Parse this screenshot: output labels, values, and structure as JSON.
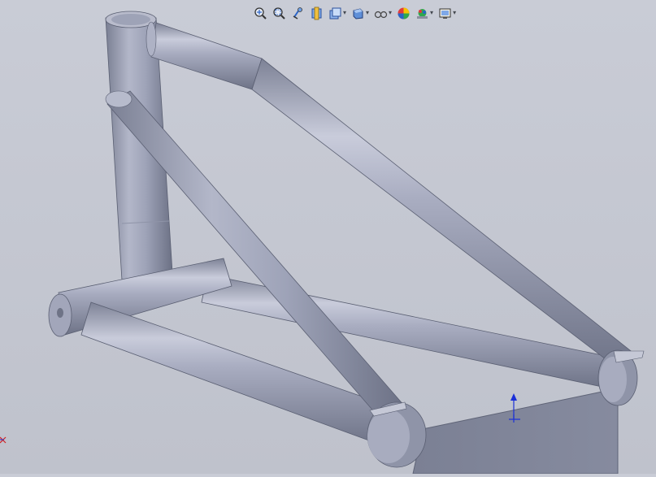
{
  "viewport": {
    "background_top": "#c9ccd6",
    "background_bottom": "#bfc2cc",
    "model_color": "#9ea3b8"
  },
  "view_toolbar": {
    "items": [
      {
        "name": "zoom-to-fit",
        "icon": "zoom-to-fit-icon",
        "has_dropdown": false
      },
      {
        "name": "zoom-to-area",
        "icon": "zoom-to-area-icon",
        "has_dropdown": false
      },
      {
        "name": "previous-view",
        "icon": "previous-view-icon",
        "has_dropdown": false
      },
      {
        "name": "section-view",
        "icon": "section-view-icon",
        "has_dropdown": false
      },
      {
        "name": "view-orientation",
        "icon": "view-orientation-icon",
        "has_dropdown": true
      },
      {
        "name": "display-style",
        "icon": "display-style-icon",
        "has_dropdown": true
      },
      {
        "name": "hide-show-items",
        "icon": "hide-show-items-icon",
        "has_dropdown": true
      },
      {
        "name": "edit-appearance",
        "icon": "edit-appearance-icon",
        "has_dropdown": false
      },
      {
        "name": "apply-scene",
        "icon": "apply-scene-icon",
        "has_dropdown": true
      },
      {
        "name": "view-settings",
        "icon": "view-settings-icon",
        "has_dropdown": true
      }
    ]
  },
  "triad": {
    "colors": {
      "y": "#1a2fd8",
      "x": "#d42020"
    }
  }
}
